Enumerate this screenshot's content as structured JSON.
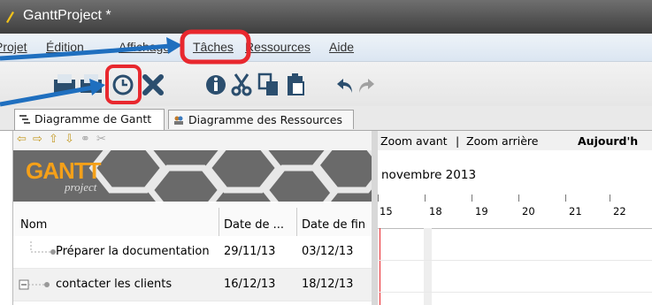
{
  "window": {
    "title": "GanttProject *"
  },
  "menu": {
    "items": [
      "Projet",
      "Édition",
      "Affichage",
      "Tâches",
      "Ressources",
      "Aide"
    ]
  },
  "tabs": {
    "gantt": "Diagramme de Gantt",
    "resources": "Diagramme des Ressources"
  },
  "logo": {
    "main": "GANTT",
    "sub": "project"
  },
  "table": {
    "headers": {
      "name": "Nom",
      "start": "Date de ...",
      "end": "Date de fin"
    },
    "rows": [
      {
        "name": "Préparer la documentation",
        "start": "29/11/13",
        "end": "03/12/13"
      },
      {
        "name": "contacter les clients",
        "start": "16/12/13",
        "end": "18/12/13"
      }
    ]
  },
  "chart": {
    "zoom_in": "Zoom avant",
    "separator": "|",
    "zoom_out": "Zoom arrière",
    "today": "Aujourd'h",
    "month": "novembre 2013",
    "days": [
      "15",
      "18",
      "19",
      "20",
      "21",
      "22"
    ]
  },
  "colors": {
    "highlight": "#e8282e",
    "arrow": "#1f6fbf"
  }
}
